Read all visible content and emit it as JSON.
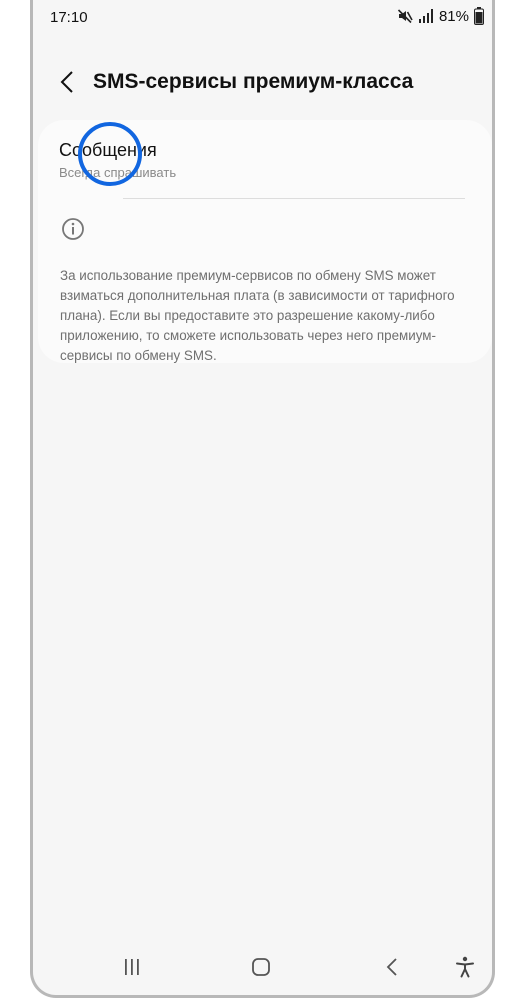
{
  "status_bar": {
    "time": "17:10",
    "battery_percent": "81%",
    "icons": [
      "mute-icon",
      "signal-icon",
      "battery-icon"
    ]
  },
  "header": {
    "back_icon": "chevron-left-icon",
    "title": "SMS-сервисы премиум-класса"
  },
  "setting": {
    "title": "Сообщения",
    "subtitle": "Всегда спрашивать"
  },
  "info": {
    "icon": "info-icon",
    "text": "За использование премиум-сервисов по обмену SMS может взиматься дополнительная плата (в зависимости от тарифного плана). Если вы предоставите это разрешение какому-либо приложению, то сможете использовать через него премиум-сервисы по обмену SMS."
  },
  "nav_bar": {
    "icons": [
      "recents-icon",
      "home-icon",
      "back-nav-icon",
      "accessibility-icon"
    ]
  },
  "colors": {
    "background": "#f6f6f6",
    "card": "#fbfbfb",
    "highlight": "#1166e0",
    "text_primary": "#111111",
    "text_secondary": "#8a8a8a"
  }
}
